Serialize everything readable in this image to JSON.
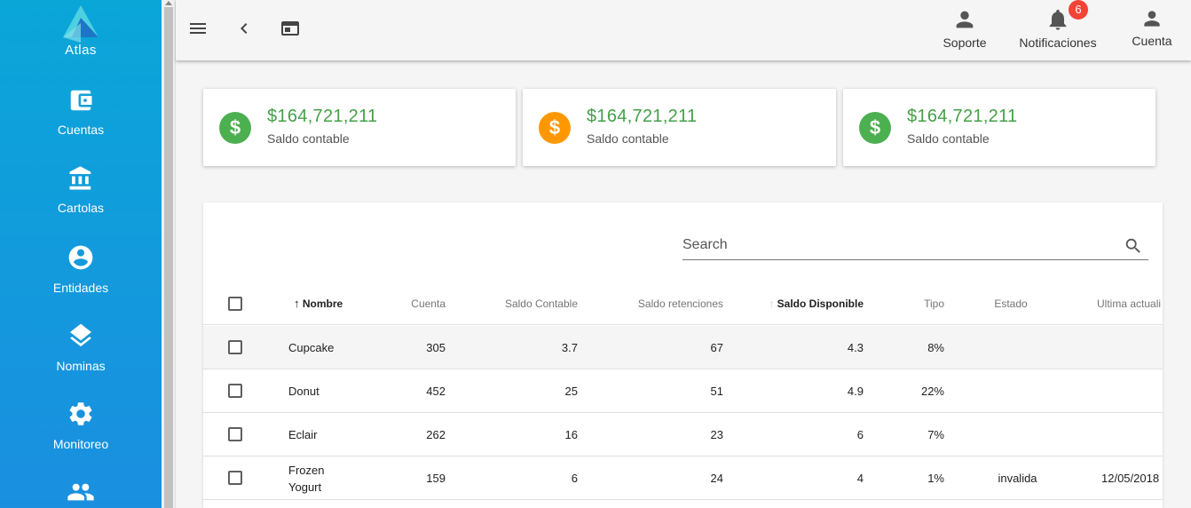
{
  "app": {
    "name": "Atlas"
  },
  "sidebar": {
    "items": [
      {
        "label": "Cuentas",
        "icon": "wallet-icon"
      },
      {
        "label": "Cartolas",
        "icon": "bank-icon"
      },
      {
        "label": "Entidades",
        "icon": "account-circle-icon"
      },
      {
        "label": "Nominas",
        "icon": "layers-icon"
      },
      {
        "label": "Monitoreo",
        "icon": "gear-icon"
      },
      {
        "label": "",
        "icon": "people-icon"
      }
    ]
  },
  "topbar": {
    "soporte_label": "Soporte",
    "notificaciones_label": "Notificaciones",
    "notification_count": "6",
    "cuenta_label": "Cuenta"
  },
  "cards": [
    {
      "amount": "$164,721,211",
      "label": "Saldo contable",
      "icon_symbol": "$",
      "color": "#4caf50"
    },
    {
      "amount": "$164,721,211",
      "label": "Saldo contable",
      "icon_symbol": "$",
      "color": "#ff9800"
    },
    {
      "amount": "$164,721,211",
      "label": "Saldo contable",
      "icon_symbol": "$",
      "color": "#4caf50"
    }
  ],
  "table": {
    "search_placeholder": "Search",
    "columns": [
      "Nombre",
      "Cuenta",
      "Saldo Contable",
      "Saldo retenciones",
      "Saldo Disponible",
      "Tipo",
      "Estado",
      "Ultima actuali"
    ],
    "rows": [
      {
        "nombre": "Cupcake",
        "nombre2": "",
        "cuenta": "305",
        "saldo_contable": "3.7",
        "saldo_retenciones": "67",
        "saldo_disponible": "4.3",
        "tipo": "8%",
        "estado": "",
        "ultima": ""
      },
      {
        "nombre": "Donut",
        "nombre2": "",
        "cuenta": "452",
        "saldo_contable": "25",
        "saldo_retenciones": "51",
        "saldo_disponible": "4.9",
        "tipo": "22%",
        "estado": "",
        "ultima": ""
      },
      {
        "nombre": "Eclair",
        "nombre2": "",
        "cuenta": "262",
        "saldo_contable": "16",
        "saldo_retenciones": "23",
        "saldo_disponible": "6",
        "tipo": "7%",
        "estado": "",
        "ultima": ""
      },
      {
        "nombre": "Frozen",
        "nombre2": "Yogurt",
        "cuenta": "159",
        "saldo_contable": "6",
        "saldo_retenciones": "24",
        "saldo_disponible": "4",
        "tipo": "1%",
        "estado": "invalida",
        "ultima": "12/05/2018"
      }
    ]
  }
}
